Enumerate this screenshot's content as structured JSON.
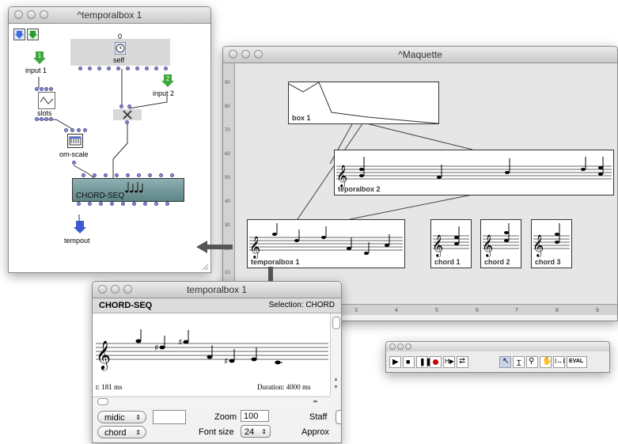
{
  "patch_window": {
    "title": "^temporalbox 1",
    "self_label": "self",
    "self_count": "0",
    "input1_number": "1",
    "input1_label": "input 1",
    "input2_number": "2",
    "input2_label": "input 2",
    "slots_label": "slots",
    "omscale_label": "om-scale",
    "chordseq_label": "CHORD-SEQ",
    "tempout_label": "tempout"
  },
  "maquette_window": {
    "title": "^Maquette",
    "ruler_y": [
      "90",
      "80",
      "70",
      "60",
      "50",
      "40",
      "30",
      "20",
      "10"
    ],
    "ruler_x": [
      "3",
      "4",
      "5",
      "6",
      "7",
      "8",
      "9"
    ],
    "boxes": {
      "box1": "box 1",
      "teporalbox2": "teporalbox 2",
      "temporalbox1": "temporalbox 1",
      "chord1": "chord 1",
      "chord2": "chord 2",
      "chord3": "chord 3"
    }
  },
  "editor_window": {
    "title": "temporalbox 1",
    "header_left": "CHORD-SEQ",
    "header_right": "Selection: CHORD",
    "time_label": "t: 181 ms",
    "duration_label": "Duration: 4000 ms",
    "mode_select": "midic",
    "view_select": "chord",
    "zoom_label": "Zoom",
    "zoom_value": "100",
    "fontsize_label": "Font size",
    "fontsize_value": "24",
    "staff_label": "Staff",
    "approx_label": "Approx"
  },
  "palette": {
    "eval_label": "EVAL",
    "buttons": [
      "play",
      "stop",
      "pause",
      "record",
      "play-selection",
      "loop",
      "arrow",
      "i-beam",
      "zoom",
      "hand",
      "interval",
      "eval"
    ]
  },
  "colors": {
    "accent_green": "#3aa83a",
    "blue_arrow": "#3a6ee0",
    "inlet_purple": "#8a8ad0",
    "chordseq_teal": "#6f9a9c",
    "record_red": "#cc0000"
  }
}
